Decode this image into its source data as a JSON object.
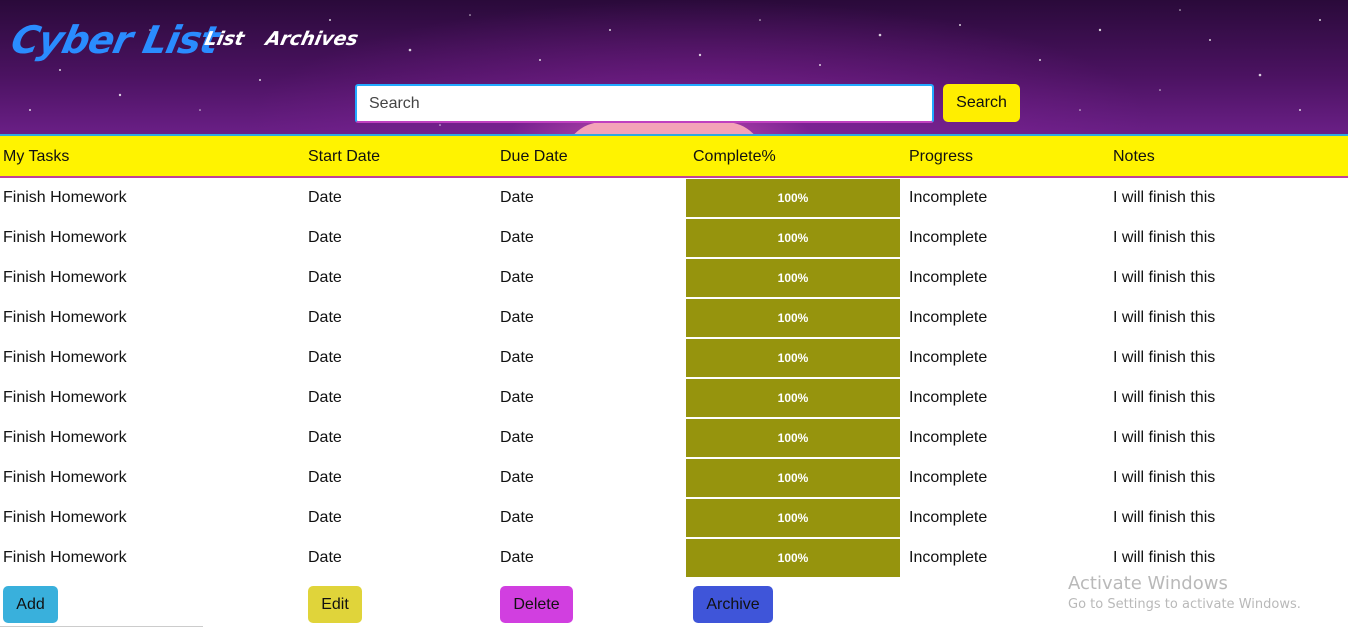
{
  "header": {
    "logo": "Cyber List",
    "nav": [
      "List",
      "Archives"
    ],
    "search": {
      "placeholder": "Search",
      "button_label": "Search"
    }
  },
  "table": {
    "columns": [
      "My Tasks",
      "Start Date",
      "Due Date",
      "Complete%",
      "Progress",
      "Notes"
    ],
    "rows": [
      {
        "task": "Finish Homework",
        "start": "Date",
        "due": "Date",
        "complete": "100%",
        "progress": "Incomplete",
        "notes": "I will finish this"
      },
      {
        "task": "Finish Homework",
        "start": "Date",
        "due": "Date",
        "complete": "100%",
        "progress": "Incomplete",
        "notes": "I will finish this"
      },
      {
        "task": "Finish Homework",
        "start": "Date",
        "due": "Date",
        "complete": "100%",
        "progress": "Incomplete",
        "notes": "I will finish this"
      },
      {
        "task": "Finish Homework",
        "start": "Date",
        "due": "Date",
        "complete": "100%",
        "progress": "Incomplete",
        "notes": "I will finish this"
      },
      {
        "task": "Finish Homework",
        "start": "Date",
        "due": "Date",
        "complete": "100%",
        "progress": "Incomplete",
        "notes": "I will finish this"
      },
      {
        "task": "Finish Homework",
        "start": "Date",
        "due": "Date",
        "complete": "100%",
        "progress": "Incomplete",
        "notes": "I will finish this"
      },
      {
        "task": "Finish Homework",
        "start": "Date",
        "due": "Date",
        "complete": "100%",
        "progress": "Incomplete",
        "notes": "I will finish this"
      },
      {
        "task": "Finish Homework",
        "start": "Date",
        "due": "Date",
        "complete": "100%",
        "progress": "Incomplete",
        "notes": "I will finish this"
      },
      {
        "task": "Finish Homework",
        "start": "Date",
        "due": "Date",
        "complete": "100%",
        "progress": "Incomplete",
        "notes": "I will finish this"
      },
      {
        "task": "Finish Homework",
        "start": "Date",
        "due": "Date",
        "complete": "100%",
        "progress": "Incomplete",
        "notes": "I will finish this"
      }
    ]
  },
  "actions": {
    "add": "Add",
    "edit": "Edit",
    "delete": "Delete",
    "archive": "Archive"
  },
  "watermark": {
    "title": "Activate Windows",
    "subtitle": "Go to Settings to activate Windows."
  },
  "colors": {
    "header_bar": "#fff300",
    "progress_fill": "#96940d",
    "logo": "#2a8cff",
    "add": "#39b0dc",
    "edit": "#e0d43a",
    "delete": "#d13fe0",
    "archive": "#3f55d9"
  }
}
